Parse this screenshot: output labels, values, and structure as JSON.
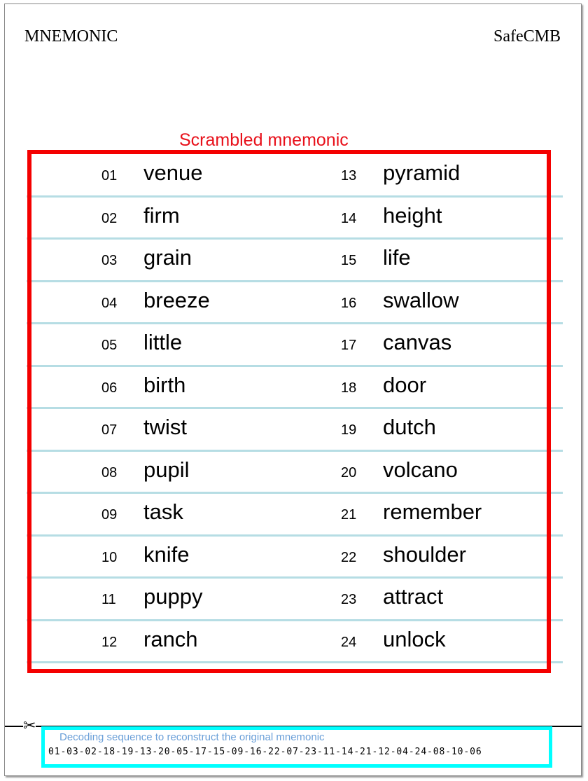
{
  "header": {
    "left_title": "MNEMONIC",
    "right_title": "SafeCMB"
  },
  "scrambled_title": "Scrambled mnemonic",
  "words_left": [
    {
      "num": "01",
      "word": "venue"
    },
    {
      "num": "02",
      "word": "firm"
    },
    {
      "num": "03",
      "word": "grain"
    },
    {
      "num": "04",
      "word": "breeze"
    },
    {
      "num": "05",
      "word": "little"
    },
    {
      "num": "06",
      "word": "birth"
    },
    {
      "num": "07",
      "word": "twist"
    },
    {
      "num": "08",
      "word": "pupil"
    },
    {
      "num": "09",
      "word": "task"
    },
    {
      "num": "10",
      "word": "knife"
    },
    {
      "num": "11",
      "word": "puppy"
    },
    {
      "num": "12",
      "word": "ranch"
    }
  ],
  "words_right": [
    {
      "num": "13",
      "word": "pyramid"
    },
    {
      "num": "14",
      "word": "height"
    },
    {
      "num": "15",
      "word": "life"
    },
    {
      "num": "16",
      "word": "swallow"
    },
    {
      "num": "17",
      "word": "canvas"
    },
    {
      "num": "18",
      "word": "door"
    },
    {
      "num": "19",
      "word": "dutch"
    },
    {
      "num": "20",
      "word": "volcano"
    },
    {
      "num": "21",
      "word": "remember"
    },
    {
      "num": "22",
      "word": "shoulder"
    },
    {
      "num": "23",
      "word": "attract"
    },
    {
      "num": "24",
      "word": "unlock"
    }
  ],
  "scissors_icon": "scissors-icon",
  "decoding": {
    "title": "Decoding sequence to reconstruct the original mnemonic",
    "sequence": "01-03-02-18-19-13-20-05-17-15-09-16-22-07-23-11-14-21-12-04-24-08-10-06"
  },
  "colors": {
    "frame_red": "#f40000",
    "title_red": "#e8101a",
    "rule_blue": "#b6dde4",
    "frame_cyan": "#00ffff",
    "decoding_title_blue": "#6a9fd8"
  }
}
